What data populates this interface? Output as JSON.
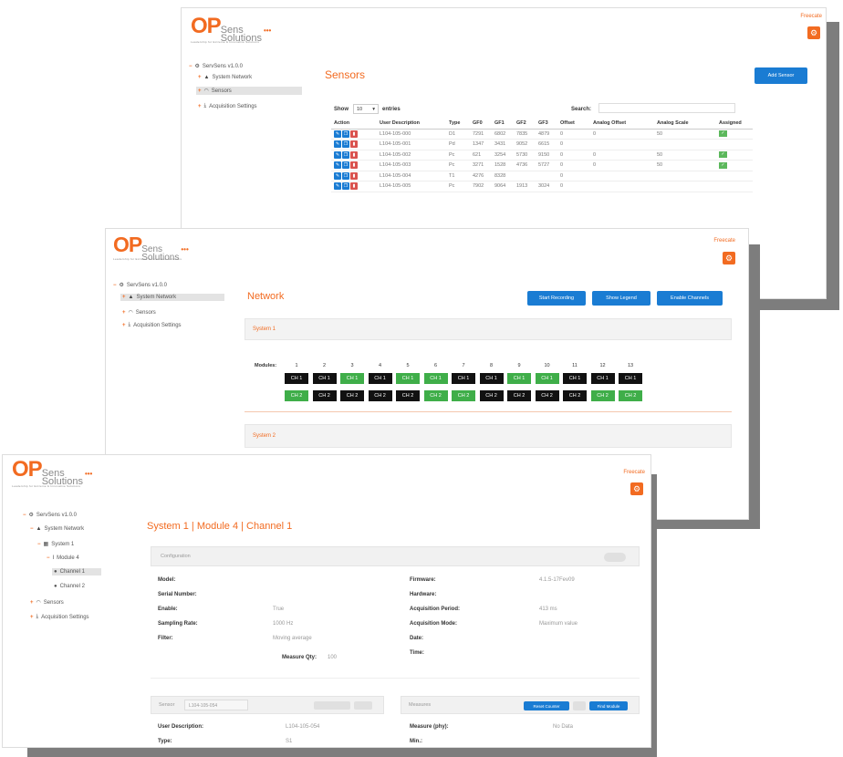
{
  "brand": {
    "op": "OP",
    "sens": "Sens",
    "solutions": "Solutions",
    "dots": "•••",
    "tagline": "Leadership for Extreme & Innovative Solutions"
  },
  "colors": {
    "accent": "#f26b21",
    "primary": "#1a7cd3",
    "danger": "#d9534f",
    "success": "#5cb85c",
    "channel_on": "#3fae49",
    "channel_off": "#111111"
  },
  "user": "Freecate",
  "icons": {
    "settings": "gear-icon",
    "tree_root": "cog-icon",
    "network": "network-icon",
    "sensors": "sensors-icon",
    "acquisition": "download-icon",
    "server": "server-icon",
    "module": "module-icon",
    "edit": "pencil-icon",
    "copy": "copy-icon",
    "delete": "trash-icon",
    "assigned": "check-icon"
  },
  "tree": {
    "root": "ServSens v1.0.0",
    "network": "System Network",
    "sensors": "Sensors",
    "acquisition": "Acquisition Settings",
    "system1": "System 1",
    "module4": "Module 4",
    "channel1": "Channel 1",
    "channel2": "Channel 2"
  },
  "sensors_page": {
    "title": "Sensors",
    "add_button": "Add Sensor",
    "show": "Show",
    "page_size": "10",
    "entries": "entries",
    "search_label": "Search:",
    "search_value": "",
    "columns": [
      "Action",
      "User Description",
      "Type",
      "GF0",
      "GF1",
      "GF2",
      "GF3",
      "Offset",
      "Analog Offset",
      "Analog Scale",
      "Assigned"
    ],
    "rows": [
      {
        "desc": "L104-105-000",
        "type": "D1",
        "gf0": "7291",
        "gf1": "6802",
        "gf2": "7835",
        "gf3": "4879",
        "offset": "0",
        "aoff": "0",
        "ascale": "50",
        "assigned": true
      },
      {
        "desc": "L104-105-001",
        "type": "Pd",
        "gf0": "1347",
        "gf1": "3431",
        "gf2": "9052",
        "gf3": "6615",
        "offset": "0",
        "aoff": "",
        "ascale": "",
        "assigned": false
      },
      {
        "desc": "L104-105-002",
        "type": "Pc",
        "gf0": "621",
        "gf1": "3254",
        "gf2": "5730",
        "gf3": "9150",
        "offset": "0",
        "aoff": "0",
        "ascale": "50",
        "assigned": true
      },
      {
        "desc": "L104-105-003",
        "type": "Pc",
        "gf0": "3271",
        "gf1": "1528",
        "gf2": "4736",
        "gf3": "5727",
        "offset": "0",
        "aoff": "0",
        "ascale": "50",
        "assigned": true
      },
      {
        "desc": "L104-105-004",
        "type": "T1",
        "gf0": "4276",
        "gf1": "8328",
        "gf2": "",
        "gf3": "",
        "offset": "0",
        "aoff": "",
        "ascale": "",
        "assigned": false
      },
      {
        "desc": "L104-105-005",
        "type": "Pc",
        "gf0": "7902",
        "gf1": "9064",
        "gf2": "1913",
        "gf3": "3024",
        "offset": "0",
        "aoff": "",
        "ascale": "",
        "assigned": false
      }
    ]
  },
  "network_page": {
    "title": "Network",
    "start_recording": "Start Recording",
    "show_legend": "Show Legend",
    "enable_channels": "Enable Channels",
    "system1": "System 1",
    "system2": "System 2",
    "modules_label": "Modules:",
    "modules": [
      "1",
      "2",
      "3",
      "4",
      "5",
      "6",
      "7",
      "8",
      "9",
      "10",
      "11",
      "12",
      "13"
    ],
    "ch1_label": "CH 1",
    "ch2_label": "CH 2",
    "ch1_active": [
      false,
      false,
      true,
      false,
      true,
      true,
      false,
      false,
      true,
      true,
      false,
      false,
      false
    ],
    "ch2_active": [
      true,
      false,
      false,
      false,
      false,
      true,
      true,
      false,
      false,
      false,
      false,
      true,
      true
    ]
  },
  "channel_page": {
    "title": "System 1 | Module 4 | Channel 1",
    "config_title": "Configuration",
    "left": [
      {
        "label": "Model:",
        "value": ""
      },
      {
        "label": "Serial Number:",
        "value": ""
      },
      {
        "label": "Enable:",
        "value": "True"
      },
      {
        "label": "Sampling Rate:",
        "value": "1000 Hz"
      },
      {
        "label": "Filter:",
        "value": "Moving average"
      }
    ],
    "right": [
      {
        "label": "Firmware:",
        "value": "4.1.5-17Fev09"
      },
      {
        "label": "Hardware:",
        "value": ""
      },
      {
        "label": "Acquisition Period:",
        "value": "413 ms"
      },
      {
        "label": "Acquisition Mode:",
        "value": "Maximum value"
      },
      {
        "label": "Date:",
        "value": ""
      },
      {
        "label": "Time:",
        "value": ""
      }
    ],
    "measure_qty_label": "Measure Qty:",
    "measure_qty_value": "100",
    "sensor_title": "Sensor",
    "sensor_select": "L104-105-054",
    "measures_title": "Measures",
    "reset_counter": "Reset Counter",
    "find_module": "Find Module",
    "sensor_fields": [
      {
        "label": "User Description:",
        "value": "L104-105-054"
      },
      {
        "label": "Type:",
        "value": "S1"
      }
    ],
    "measure_fields": [
      {
        "label": "Measure (phy):",
        "value": "No Data"
      },
      {
        "label": "Min.:",
        "value": ""
      }
    ]
  }
}
